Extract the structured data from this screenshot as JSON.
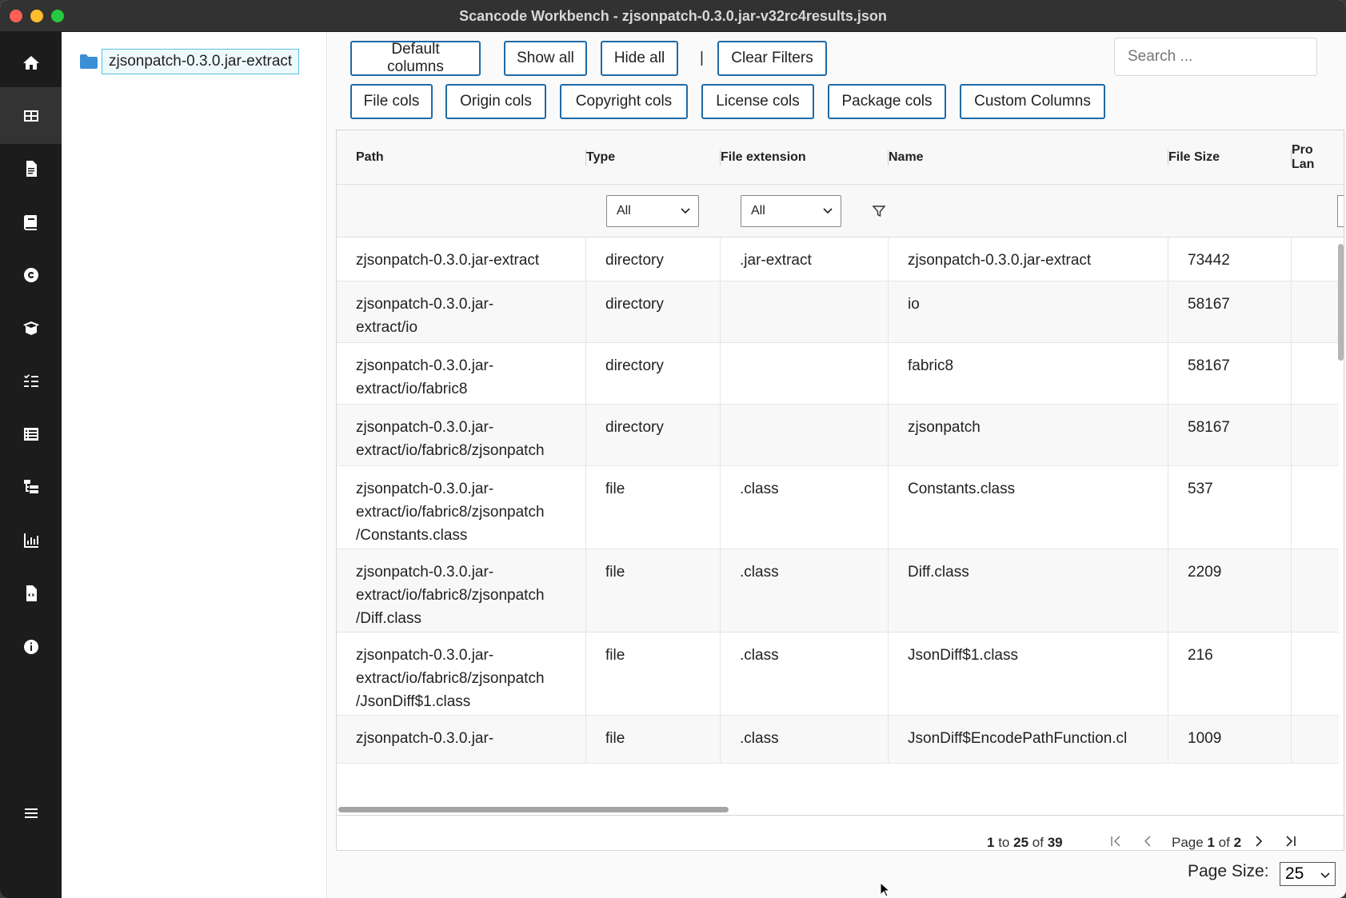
{
  "window": {
    "title": "Scancode Workbench - zjsonpatch-0.3.0.jar-v32rc4results.json"
  },
  "sidebar": {
    "items": [
      {
        "icon": "home-icon"
      },
      {
        "icon": "table-icon"
      },
      {
        "icon": "file-icon"
      },
      {
        "icon": "book-icon"
      },
      {
        "icon": "copyright-icon"
      },
      {
        "icon": "package-icon"
      },
      {
        "icon": "checklist-icon"
      },
      {
        "icon": "list-icon"
      },
      {
        "icon": "hierarchy-icon"
      },
      {
        "icon": "bar-chart-icon"
      },
      {
        "icon": "file-code-icon"
      },
      {
        "icon": "info-icon"
      },
      {
        "icon": "menu-icon"
      }
    ]
  },
  "tree": {
    "root_label": "zjsonpatch-0.3.0.jar-extract"
  },
  "toolbar": {
    "default_columns": "Default columns",
    "show_all": "Show all",
    "hide_all": "Hide all",
    "separator": "|",
    "clear_filters": "Clear Filters",
    "file_cols": "File cols",
    "origin_cols": "Origin cols",
    "copyright_cols": "Copyright cols",
    "license_cols": "License cols",
    "package_cols": "Package cols",
    "custom_columns": "Custom Columns",
    "search_placeholder": "Search ..."
  },
  "table": {
    "headers": {
      "path": "Path",
      "type": "Type",
      "file_extension": "File extension",
      "name": "Name",
      "file_size": "File Size",
      "programming_language": "Pro\nLan"
    },
    "filters": {
      "type": "All",
      "file_extension": "All"
    },
    "rows": [
      {
        "path": "zjsonpatch-0.3.0.jar-extract",
        "type": "directory",
        "ext": ".jar-extract",
        "name": "zjsonpatch-0.3.0.jar-extract",
        "size": "73442"
      },
      {
        "path": "zjsonpatch-0.3.0.jar-\nextract/io",
        "type": "directory",
        "ext": "",
        "name": "io",
        "size": "58167"
      },
      {
        "path": "zjsonpatch-0.3.0.jar-\nextract/io/fabric8",
        "type": "directory",
        "ext": "",
        "name": "fabric8",
        "size": "58167"
      },
      {
        "path": "zjsonpatch-0.3.0.jar-\nextract/io/fabric8/zjsonpatch",
        "type": "directory",
        "ext": "",
        "name": "zjsonpatch",
        "size": "58167"
      },
      {
        "path": "zjsonpatch-0.3.0.jar-\nextract/io/fabric8/zjsonpatch\n/Constants.class",
        "type": "file",
        "ext": ".class",
        "name": "Constants.class",
        "size": "537"
      },
      {
        "path": "zjsonpatch-0.3.0.jar-\nextract/io/fabric8/zjsonpatch\n/Diff.class",
        "type": "file",
        "ext": ".class",
        "name": "Diff.class",
        "size": "2209"
      },
      {
        "path": "zjsonpatch-0.3.0.jar-\nextract/io/fabric8/zjsonpatch\n/JsonDiff$1.class",
        "type": "file",
        "ext": ".class",
        "name": "JsonDiff$1.class",
        "size": "216"
      },
      {
        "path": "zjsonpatch-0.3.0.jar-",
        "type": "file",
        "ext": ".class",
        "name": "JsonDiff$EncodePathFunction.cl",
        "size": "1009"
      }
    ]
  },
  "pagination": {
    "from": "1",
    "to_word": "to",
    "to": "25",
    "of_word": "of",
    "total": "39",
    "page_word": "Page",
    "page": "1",
    "page_of_word": "of",
    "pages": "2"
  },
  "page_size": {
    "label": "Page Size:",
    "value": "25"
  }
}
